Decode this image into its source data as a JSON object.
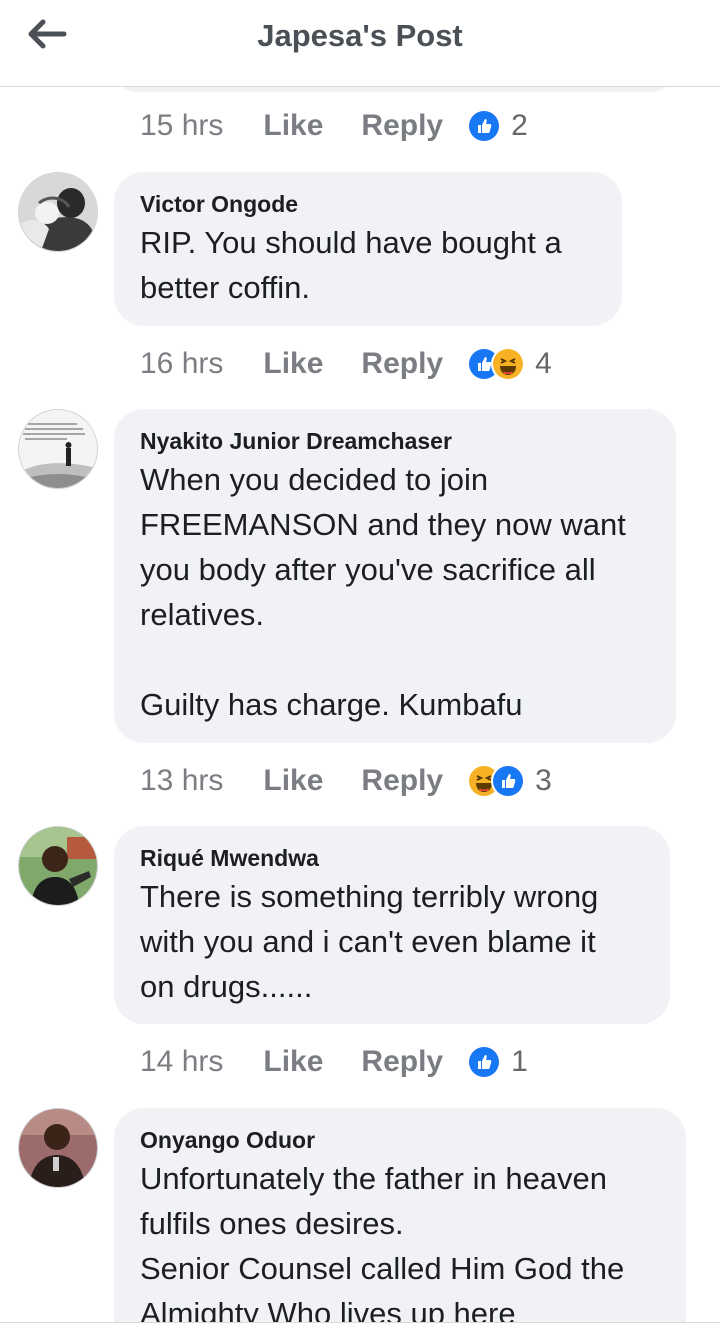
{
  "header": {
    "title": "Japesa's Post",
    "back_icon": "arrow-left-icon"
  },
  "colors": {
    "like_blue": "#1877f2",
    "haha_yellow": "#f7b125",
    "bubble_bg": "#f0f2f5",
    "meta_grey": "#65676b"
  },
  "previous_comment_meta": {
    "time": "15 hrs",
    "like": "Like",
    "reply": "Reply",
    "reactions": [
      "like"
    ],
    "reaction_count": "2"
  },
  "comments": [
    {
      "author": "Victor Ongode",
      "lines": [
        "RIP. You should have bought a",
        "better coffin."
      ],
      "time": "16 hrs",
      "like": "Like",
      "reply": "Reply",
      "reactions": [
        "like",
        "haha"
      ],
      "reaction_count": "4"
    },
    {
      "author": "Nyakito Junior Dreamchaser",
      "lines": [
        "When you decided to join",
        "FREEMANSON and they now want",
        "you body after you've sacrifice all",
        "relatives."
      ],
      "lines2": [
        "Guilty has charge. Kumbafu"
      ],
      "time": "13 hrs",
      "like": "Like",
      "reply": "Reply",
      "reactions": [
        "haha",
        "like"
      ],
      "reaction_count": "3"
    },
    {
      "author": "Riqué Mwendwa",
      "lines": [
        "There is something terribly wrong",
        "with you and i can't even blame it",
        "on drugs......"
      ],
      "time": "14 hrs",
      "like": "Like",
      "reply": "Reply",
      "reactions": [
        "like"
      ],
      "reaction_count": "1"
    },
    {
      "author": "Onyango Oduor",
      "lines": [
        "Unfortunately the father in heaven",
        "fulfils ones desires.",
        "Senior Counsel called Him God the",
        "Almighty Who lives up here"
      ]
    }
  ]
}
